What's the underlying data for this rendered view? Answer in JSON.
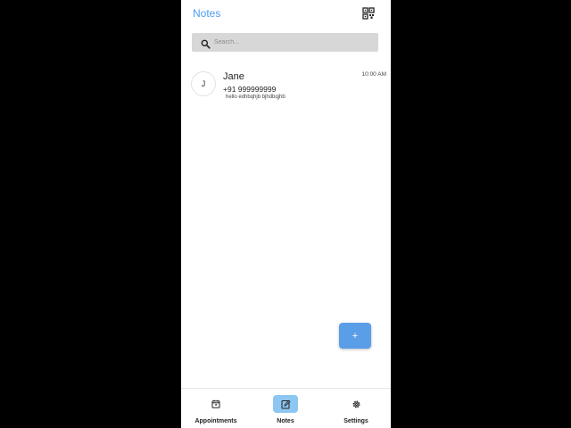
{
  "header": {
    "title": "Notes",
    "qr_icon": "qr-code-icon"
  },
  "search": {
    "placeholder": "Search...",
    "icon": "search-icon"
  },
  "notes": [
    {
      "initial": "J",
      "name": "Jane",
      "phone": "+91 999999999",
      "preview": "hello edhbqhjb bjhdbqjhb",
      "time": "10:00 AM"
    }
  ],
  "fab": {
    "label": "+",
    "icon": "add-icon"
  },
  "bottom_nav": {
    "items": [
      {
        "label": "Appointments",
        "icon": "calendar-icon",
        "active": false
      },
      {
        "label": "Notes",
        "icon": "edit-note-icon",
        "active": true
      },
      {
        "label": "Settings",
        "icon": "gear-icon",
        "active": false
      }
    ]
  },
  "colors": {
    "accent": "#4a9cf0",
    "fab": "#5b9ee8",
    "nav_active": "#8ec6f2",
    "search_bg": "#d7d7d7",
    "outer_background": "#000000"
  }
}
